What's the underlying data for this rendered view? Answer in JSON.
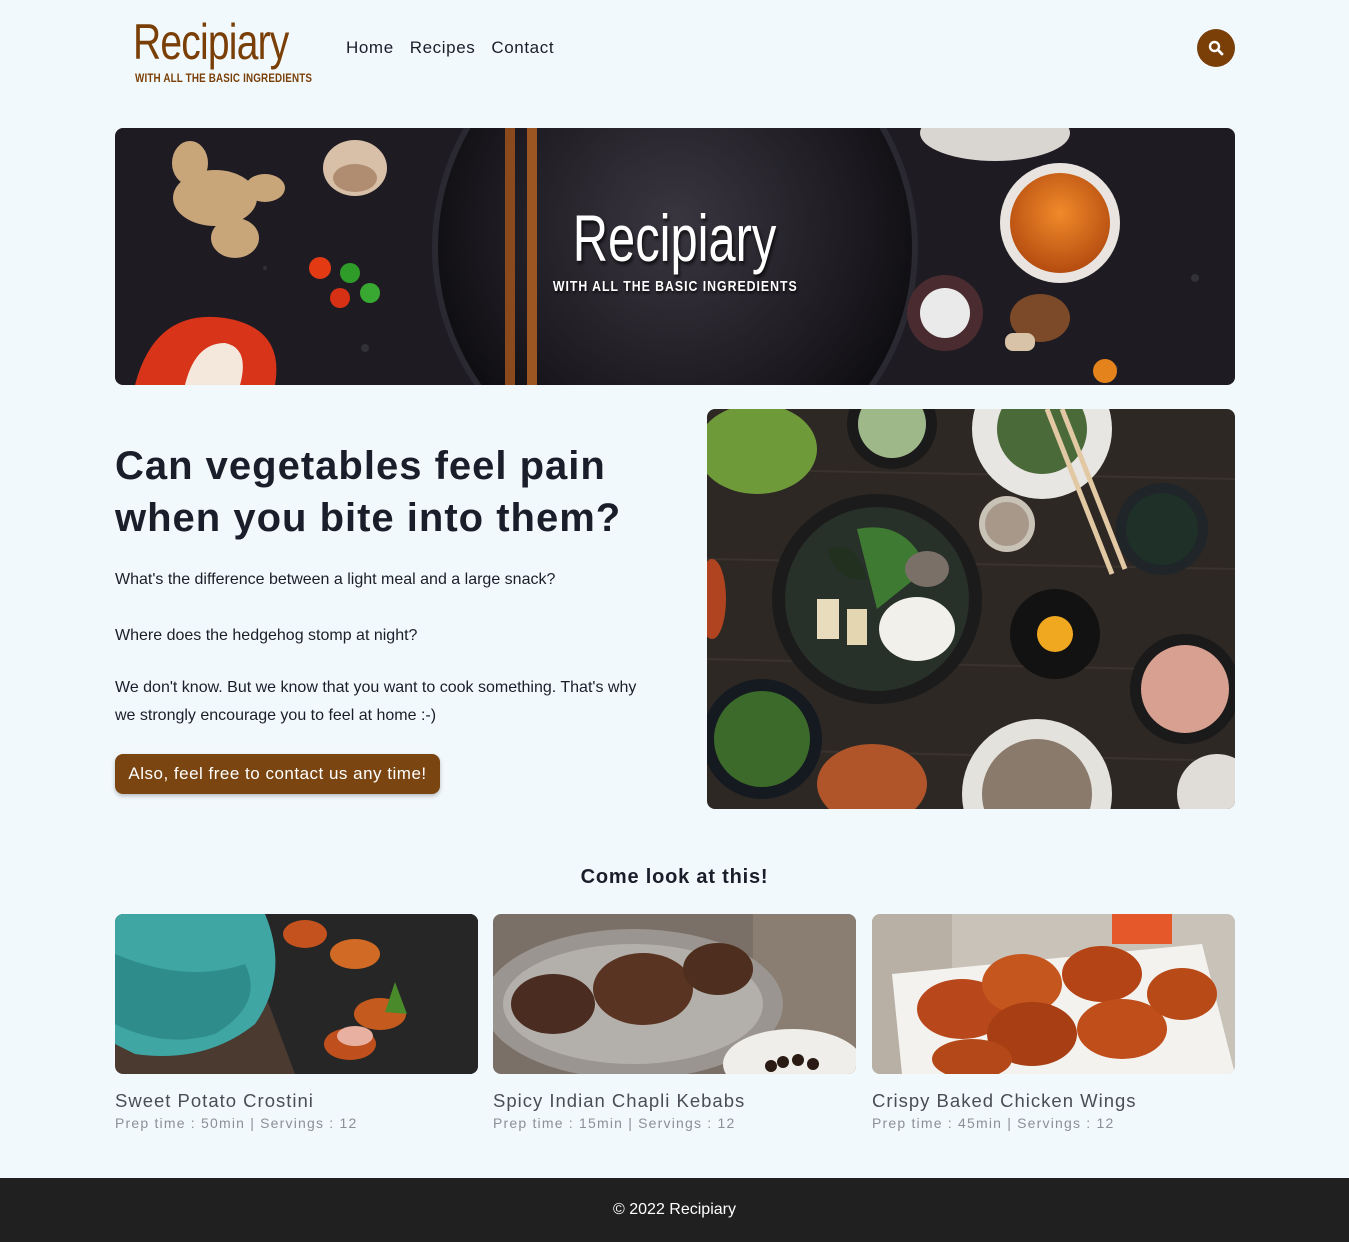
{
  "header": {
    "logo_title": "Recipiary",
    "logo_tagline": "WITH ALL THE BASIC INGREDIENTS",
    "nav": [
      {
        "label": "Home"
      },
      {
        "label": "Recipes"
      },
      {
        "label": "Contact"
      }
    ],
    "search_icon": "search-icon"
  },
  "hero": {
    "title": "Recipiary",
    "tagline": "WITH ALL THE BASIC INGREDIENTS"
  },
  "intro": {
    "heading": "Can vegetables feel pain when you bite into them?",
    "paragraphs": [
      "What's the difference between a light meal and a large snack?",
      "Where does the hedgehog stomp at night?",
      "We don't know. But we know that you want to cook something. That's why we strongly encourage you to feel at home :-)"
    ],
    "cta_label": "Also, feel free to contact us any time!"
  },
  "featured": {
    "title": "Come look at this!",
    "recipes": [
      {
        "name": "Sweet Potato Crostini",
        "meta": "Prep time : 50min | Servings : 12"
      },
      {
        "name": "Spicy Indian Chapli Kebabs",
        "meta": "Prep time : 15min | Servings : 12"
      },
      {
        "name": "Crispy Baked Chicken Wings",
        "meta": "Prep time : 45min | Servings : 12"
      }
    ]
  },
  "footer": {
    "text": "© 2022 Recipiary"
  },
  "colors": {
    "background": "#f2f9fd",
    "brand": "#7a3f07",
    "button": "#7a4510",
    "footer": "#202020"
  }
}
